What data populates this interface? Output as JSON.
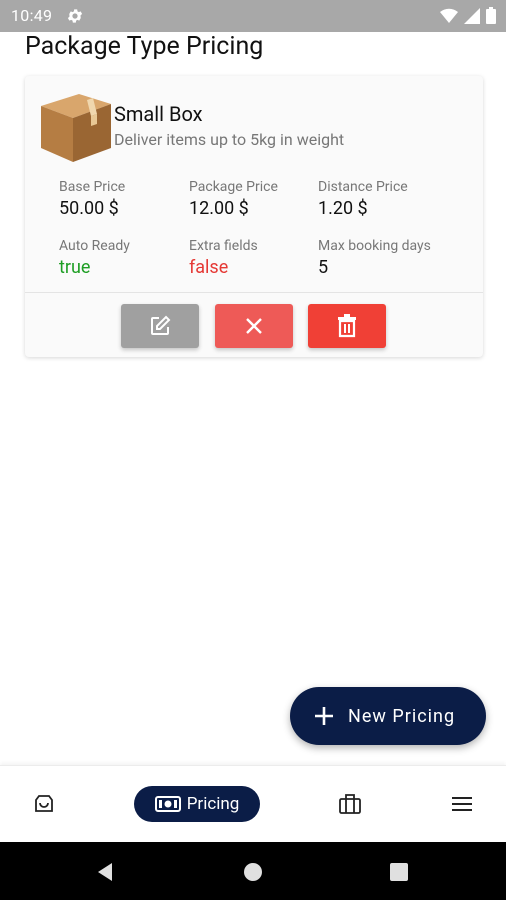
{
  "status_bar": {
    "time": "10:49"
  },
  "header": {
    "title": "Package Type Pricing"
  },
  "card": {
    "name": "Small Box",
    "description": "Deliver items up to 5kg in weight",
    "fields": [
      {
        "label": "Base Price",
        "value": "50.00 $"
      },
      {
        "label": "Package Price",
        "value": "12.00 $"
      },
      {
        "label": "Distance Price",
        "value": "1.20 $"
      },
      {
        "label": "Auto Ready",
        "value": "true"
      },
      {
        "label": "Extra fields",
        "value": "false"
      },
      {
        "label": "Max booking days",
        "value": "5"
      }
    ]
  },
  "fab": {
    "label": "New Pricing"
  },
  "bottom_nav": {
    "items": [
      {
        "icon": "orders-icon"
      },
      {
        "icon": "pricing-icon",
        "label": "Pricing"
      },
      {
        "icon": "briefcase-icon"
      },
      {
        "icon": "menu-icon"
      }
    ]
  },
  "colors": {
    "primary": "#0b1d47",
    "true_green": "#1e9e24",
    "false_red": "#e53935",
    "edit_grey": "#a0a0a0",
    "cancel_red": "#ee5a57",
    "delete_red": "#f04036"
  }
}
